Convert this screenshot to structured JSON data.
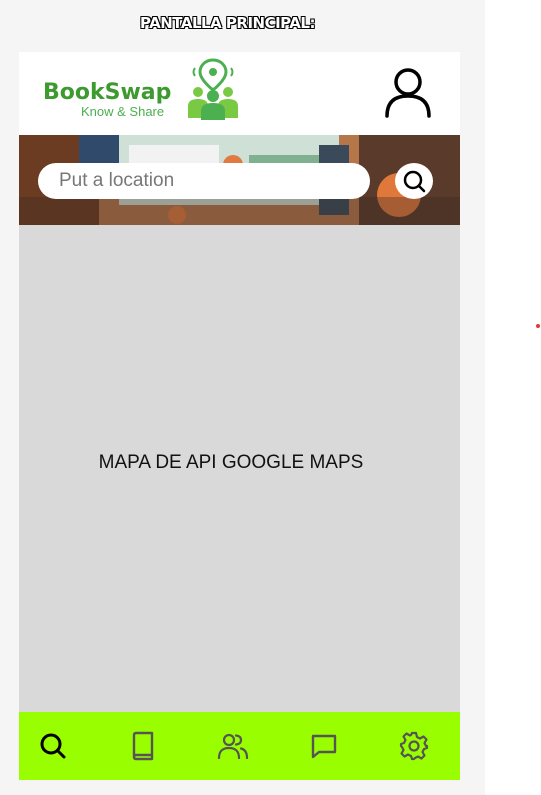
{
  "frame": {
    "title": "PANTALLA PRINCIPAL:"
  },
  "header": {
    "logo_name": "BookSwap",
    "logo_tagline": "Know & Share",
    "profile_icon": "user-outline-icon"
  },
  "search": {
    "placeholder": "Put a location",
    "value": "",
    "button_icon": "search-icon"
  },
  "map": {
    "label": "MAPA DE API GOOGLE MAPS"
  },
  "tabbar": {
    "background": "#99ff00",
    "items": [
      {
        "icon": "search-icon",
        "active": true
      },
      {
        "icon": "book-icon",
        "active": false
      },
      {
        "icon": "users-icon",
        "active": false
      },
      {
        "icon": "chat-icon",
        "active": false
      },
      {
        "icon": "settings-gear-icon",
        "active": false
      }
    ]
  },
  "colors": {
    "brand_green": "#3d9a2f",
    "tabbar_green": "#99ff00",
    "map_placeholder": "#d9d9d9"
  }
}
